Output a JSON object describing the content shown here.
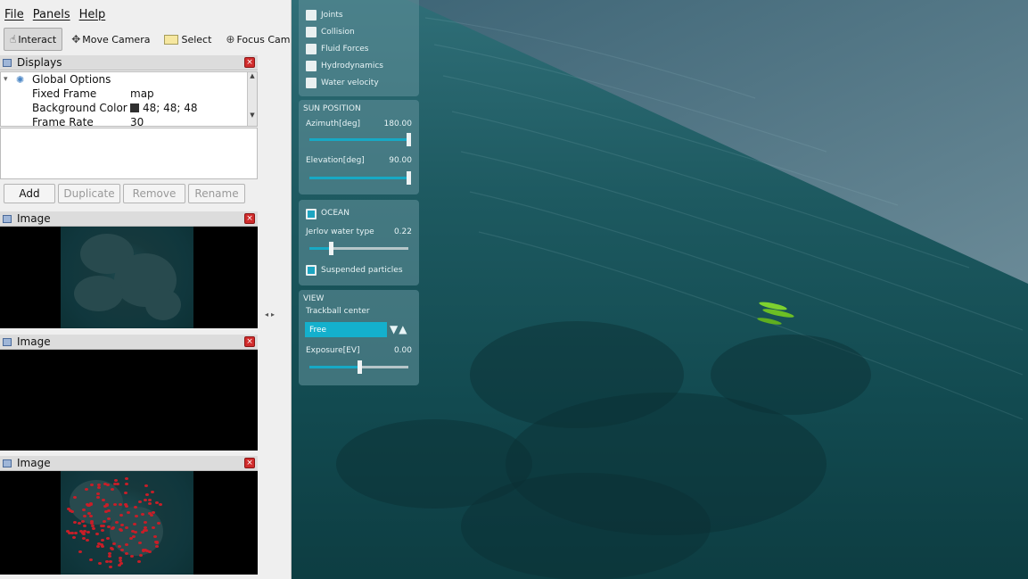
{
  "rviz": {
    "menu": [
      "File",
      "Panels",
      "Help"
    ],
    "tools": {
      "interact": "Interact",
      "move_camera": "Move Camera",
      "select": "Select",
      "focus_camera": "Focus Camera"
    },
    "displays": {
      "title": "Displays",
      "global_options": "Global Options",
      "rows": [
        {
          "key": "Fixed Frame",
          "value": "map"
        },
        {
          "key": "Background Color",
          "value": "48; 48; 48"
        },
        {
          "key": "Frame Rate",
          "value": "30"
        }
      ]
    },
    "buttons": {
      "add": "Add",
      "duplicate": "Duplicate",
      "remove": "Remove",
      "rename": "Rename"
    },
    "image_panels": [
      "Image",
      "Image",
      "Image"
    ]
  },
  "sim": {
    "display_checks": [
      {
        "label": "Joints",
        "checked": false
      },
      {
        "label": "Collision",
        "checked": false
      },
      {
        "label": "Fluid Forces",
        "checked": false
      },
      {
        "label": "Hydrodynamics",
        "checked": false
      },
      {
        "label": "Water velocity",
        "checked": false
      }
    ],
    "sun": {
      "title": "SUN POSITION",
      "azimuth_label": "Azimuth[deg]",
      "azimuth_value": "180.00",
      "azimuth_fraction": 1.0,
      "elevation_label": "Elevation[deg]",
      "elevation_value": "90.00",
      "elevation_fraction": 1.0
    },
    "ocean": {
      "label": "OCEAN",
      "checked": true,
      "jerlov_label": "Jerlov water type",
      "jerlov_value": "0.22",
      "jerlov_fraction": 0.22,
      "particles_label": "Suspended particles",
      "particles_checked": true
    },
    "view": {
      "title": "VIEW",
      "trackball_label": "Trackball center",
      "trackball_value": "Free",
      "exposure_label": "Exposure[EV]",
      "exposure_value": "0.00",
      "exposure_fraction": 0.5
    },
    "colors": {
      "accent": "#17a9c5",
      "water": "#0f3e44",
      "vehicle": "#7ed12f"
    }
  }
}
